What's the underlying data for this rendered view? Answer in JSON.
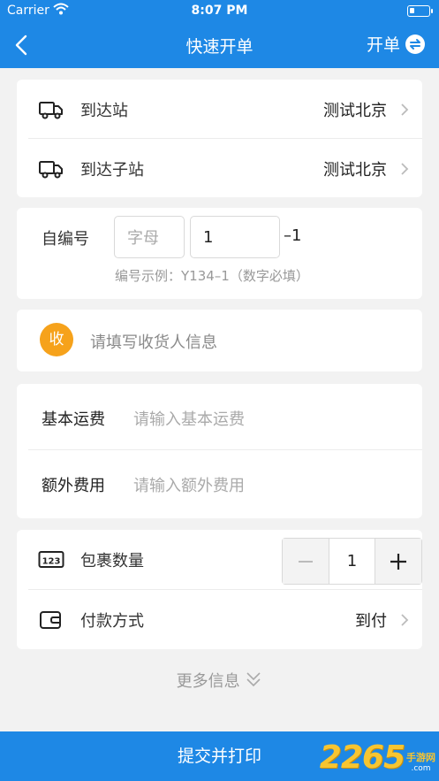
{
  "status_bar": {
    "carrier": "Carrier",
    "time": "8:07 PM"
  },
  "nav": {
    "title": "快速开单",
    "right_label": "开单"
  },
  "station": {
    "arrive_label": "到达站",
    "arrive_value": "测试北京",
    "sub_label": "到达子站",
    "sub_value": "测试北京"
  },
  "number": {
    "label": "自编号",
    "letter_placeholder": "字母",
    "number_value": "1",
    "suffix": "–1",
    "hint": "编号示例：Y134–1（数字必填）"
  },
  "receiver": {
    "badge": "收",
    "placeholder": "请填写收货人信息"
  },
  "fees": {
    "basic_label": "基本运费",
    "basic_placeholder": "请输入基本运费",
    "extra_label": "额外费用",
    "extra_placeholder": "请输入额外费用"
  },
  "package": {
    "label": "包裹数量",
    "count": "1",
    "icon": "123"
  },
  "payment": {
    "label": "付款方式",
    "value": "到付"
  },
  "more": {
    "label": "更多信息"
  },
  "submit": {
    "label": "提交并打印"
  },
  "watermark": {
    "number": "2265",
    "cn": "手游网",
    "domain": ".com"
  },
  "colors": {
    "primary": "#1e88e5",
    "badge": "#f6a21b",
    "background": "#f2f2f2"
  }
}
